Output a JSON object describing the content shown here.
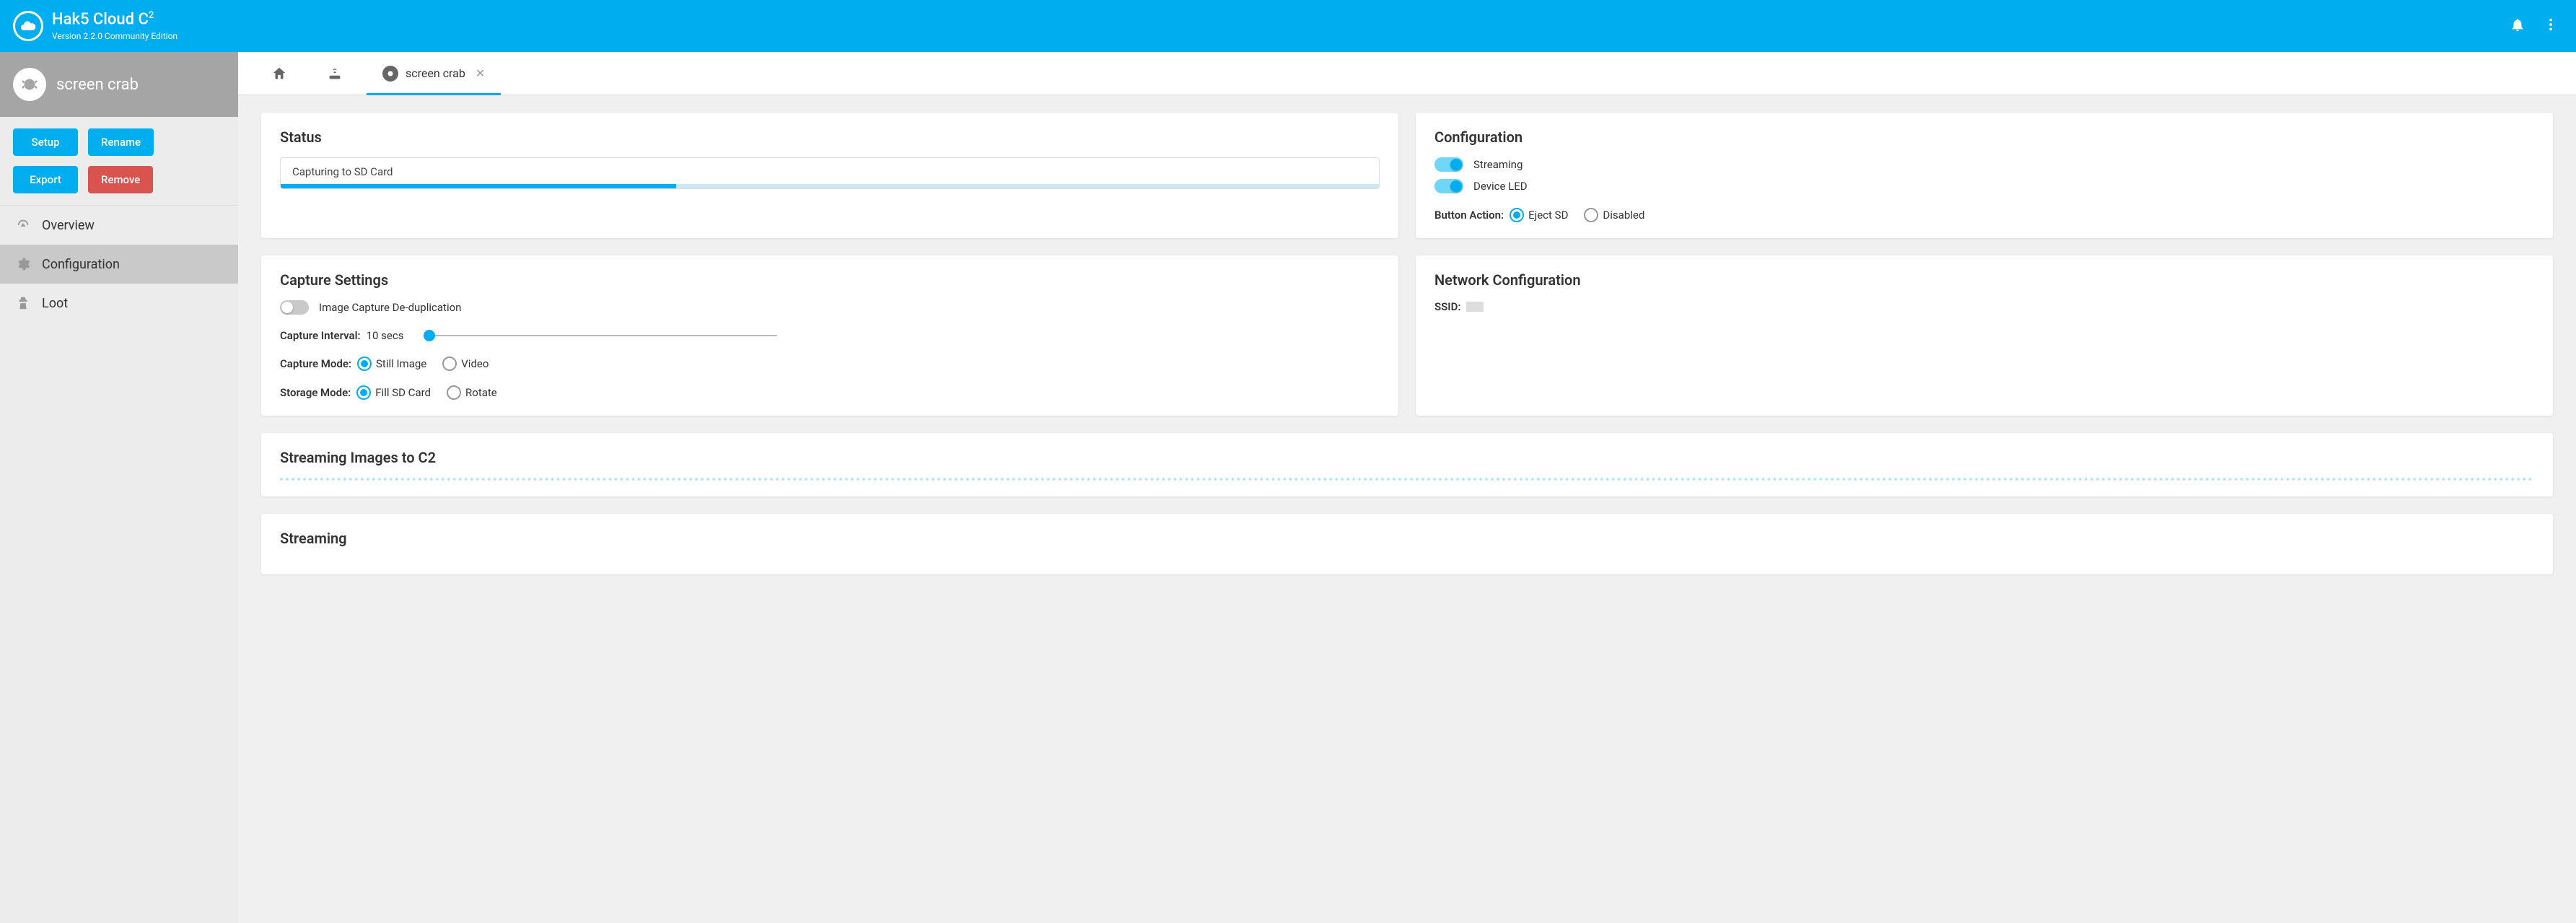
{
  "app": {
    "title_prefix": "Hak5 Cloud C",
    "title_sup": "2",
    "version_line": "Version 2.2.0 Community Edition"
  },
  "device": {
    "name": "screen crab"
  },
  "sidebar_buttons": {
    "setup": "Setup",
    "rename": "Rename",
    "export": "Export",
    "remove": "Remove"
  },
  "sidebar_nav": {
    "overview": "Overview",
    "configuration": "Configuration",
    "loot": "Loot"
  },
  "tabs": {
    "device_label": "screen crab"
  },
  "status": {
    "heading": "Status",
    "text": "Capturing to SD Card",
    "progress_percent": 36
  },
  "configuration": {
    "heading": "Configuration",
    "streaming_label": "Streaming",
    "streaming_on": true,
    "led_label": "Device LED",
    "led_on": true,
    "button_action_label": "Button Action:",
    "button_action_options": {
      "eject": "Eject SD",
      "disabled": "Disabled"
    },
    "button_action_value": "eject"
  },
  "capture": {
    "heading": "Capture Settings",
    "dedup_label": "Image Capture De-duplication",
    "dedup_on": false,
    "interval_label": "Capture Interval:",
    "interval_value": "10 secs",
    "mode_label": "Capture Mode:",
    "mode_options": {
      "still": "Still Image",
      "video": "Video"
    },
    "mode_value": "still",
    "storage_label": "Storage Mode:",
    "storage_options": {
      "fill": "Fill SD Card",
      "rotate": "Rotate"
    },
    "storage_value": "fill"
  },
  "network": {
    "heading": "Network Configuration",
    "ssid_label": "SSID:",
    "ssid_value": ""
  },
  "streaming_images": {
    "heading": "Streaming Images to C2"
  },
  "streaming": {
    "heading": "Streaming"
  }
}
